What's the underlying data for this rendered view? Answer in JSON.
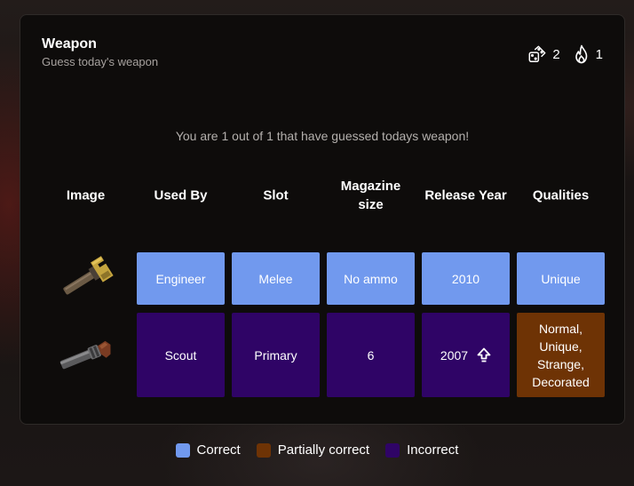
{
  "header": {
    "title": "Weapon",
    "subtitle": "Guess today's weapon"
  },
  "stats": {
    "dice_count": "2",
    "streak_count": "1"
  },
  "message": "You are 1 out of 1 that have guessed todays weapon!",
  "columns": {
    "image": "Image",
    "used_by": "Used By",
    "slot": "Slot",
    "magazine": "Magazine size",
    "release_year": "Release Year",
    "qualities": "Qualities"
  },
  "guesses": [
    {
      "image_icon": "wrench-weapon-icon",
      "used_by": "Engineer",
      "slot": "Melee",
      "magazine": "No ammo",
      "release_year": "2010",
      "qualities": "Unique",
      "status": [
        "correct",
        "correct",
        "correct",
        "correct",
        "correct"
      ]
    },
    {
      "image_icon": "scattergun-weapon-icon",
      "used_by": "Scout",
      "slot": "Primary",
      "magazine": "6",
      "release_year": "2007",
      "release_year_hint": "up-arrow",
      "qualities": "Normal,\nUnique,\nStrange,\nDecorated",
      "status": [
        "incorrect",
        "incorrect",
        "incorrect",
        "incorrect",
        "partial"
      ]
    }
  ],
  "legend": {
    "correct": "Correct",
    "partial": "Partially correct",
    "incorrect": "Incorrect"
  },
  "colors": {
    "correct": "#7199ee",
    "partial": "#6e3305",
    "incorrect": "#2f0466",
    "card_background": "#0e0c0b"
  }
}
